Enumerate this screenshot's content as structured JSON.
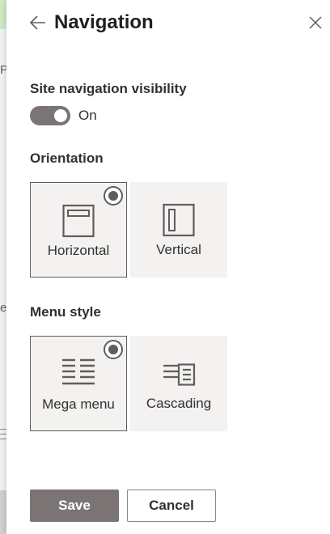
{
  "background": {
    "fragments": [
      "P",
      "e"
    ]
  },
  "panel": {
    "title": "Navigation",
    "back_icon": "back-arrow-icon",
    "close_icon": "close-icon"
  },
  "site_nav": {
    "label": "Site navigation visibility",
    "toggle_state": "On",
    "toggle_on": true
  },
  "orientation": {
    "label": "Orientation",
    "options": [
      {
        "label": "Horizontal",
        "icon": "horizontal-layout-icon",
        "selected": true
      },
      {
        "label": "Vertical",
        "icon": "vertical-layout-icon",
        "selected": false
      }
    ]
  },
  "menu_style": {
    "label": "Menu style",
    "options": [
      {
        "label": "Mega menu",
        "icon": "mega-menu-icon",
        "selected": true
      },
      {
        "label": "Cascading",
        "icon": "cascading-menu-icon",
        "selected": false
      }
    ]
  },
  "footer": {
    "save_label": "Save",
    "cancel_label": "Cancel"
  },
  "colors": {
    "accent": "#7a7574",
    "tile_bg": "#f3f2f1",
    "text": "#323130"
  }
}
